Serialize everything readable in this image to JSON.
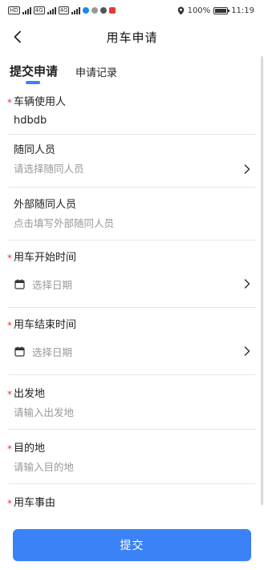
{
  "status_bar": {
    "signal_badges": [
      "HD",
      "4G",
      "4G"
    ],
    "battery": "100%",
    "time": "11:19"
  },
  "header": {
    "title": "用车申请"
  },
  "tabs": [
    {
      "label": "提交申请",
      "active": true
    },
    {
      "label": "申请记录",
      "active": false
    }
  ],
  "form": {
    "vehicle_user": {
      "label": "车辆使用人",
      "required": "*",
      "value": "hdbdb"
    },
    "accompanying": {
      "label": "随同人员",
      "placeholder": "请选择随同人员"
    },
    "external": {
      "label": "外部随同人员",
      "placeholder": "点击填写外部随同人员"
    },
    "start_time": {
      "label": "用车开始时间",
      "required": "*",
      "placeholder": "选择日期"
    },
    "end_time": {
      "label": "用车结束时间",
      "required": "*",
      "placeholder": "选择日期"
    },
    "departure": {
      "label": "出发地",
      "required": "*",
      "placeholder": "请输入出发地"
    },
    "destination": {
      "label": "目的地",
      "required": "*",
      "placeholder": "请输入目的地"
    },
    "reason": {
      "label": "用车事由",
      "required": "*"
    }
  },
  "submit": {
    "label": "提交"
  },
  "colors": {
    "accent": "#3b82f6",
    "required": "#e53935",
    "placeholder": "#999999"
  },
  "icons": {
    "back": "chevron-left-icon",
    "select": "chevron-right-icon",
    "date": "calendar-icon"
  }
}
